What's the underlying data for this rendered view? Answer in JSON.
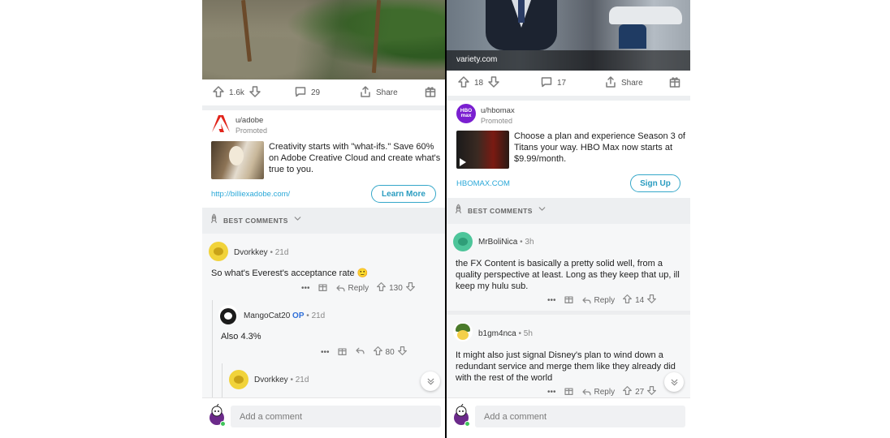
{
  "left": {
    "post_actions": {
      "upvotes": "1.6k",
      "comments": "29",
      "share_label": "Share"
    },
    "promo": {
      "user": "u/adobe",
      "tag": "Promoted",
      "text": "Creativity starts with \"what-ifs.\" Save 60% on Adobe Creative Cloud and create what's true to you.",
      "link": "http://billiexadobe.com/",
      "button": "Learn More",
      "brand_color": "#e1251b"
    },
    "sort_label": "BEST COMMENTS",
    "comments": [
      {
        "author": "Dvorkkey",
        "time": "21d",
        "body": "So what's Everest's acceptance rate 🙂",
        "reply": "Reply",
        "score": "130",
        "more": "•••"
      },
      {
        "author": "MangoCat20",
        "op": "OP",
        "time": "21d",
        "body": "Also 4.3%",
        "score": "80",
        "more": "•••"
      },
      {
        "author": "Dvorkkey",
        "time": "21d"
      }
    ],
    "comment_placeholder": "Add a comment"
  },
  "right": {
    "source": "variety.com",
    "post_actions": {
      "upvotes": "18",
      "comments": "17",
      "share_label": "Share"
    },
    "promo": {
      "user": "u/hbomax",
      "tag": "Promoted",
      "logo_text": "HBO max",
      "text": "Choose a plan and experience Season 3 of Titans your way. HBO Max now starts at $9.99/month.",
      "link": "HBOMAX.COM",
      "button": "Sign Up",
      "brand_color": "#7a1fd0"
    },
    "sort_label": "BEST COMMENTS",
    "comments": [
      {
        "author": "MrBoliNica",
        "time": "3h",
        "body": "the FX Content is basically a pretty solid well, from a quality perspective at least. Long as they keep that up, ill keep my hulu sub.",
        "reply": "Reply",
        "score": "14",
        "more": "•••"
      },
      {
        "author": "b1gm4nca",
        "time": "5h",
        "body": "It might also just signal Disney's plan to wind down a redundant service and merge them like they already did with the rest of the world",
        "reply": "Reply",
        "score": "27",
        "more": "•••"
      }
    ],
    "comment_placeholder": "Add a comment"
  },
  "accent_color": "#2aa8d8"
}
